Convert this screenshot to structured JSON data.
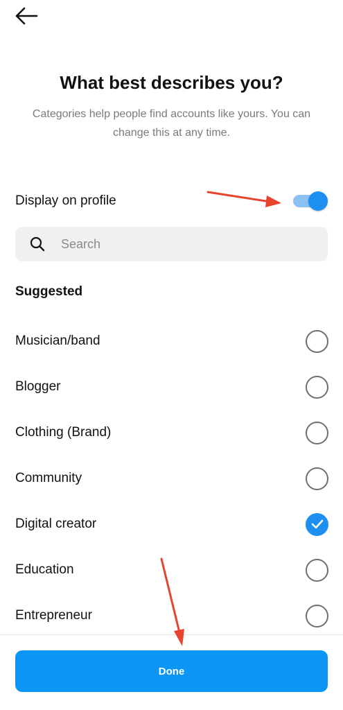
{
  "header": {
    "back_icon": "arrow-left-icon"
  },
  "intro": {
    "title": "What best describes you?",
    "subtitle": "Categories help people find accounts like yours. You can change this at any time."
  },
  "display_on_profile": {
    "label": "Display on profile",
    "enabled": true
  },
  "search": {
    "placeholder": "Search",
    "value": "",
    "icon": "search-icon"
  },
  "suggested": {
    "title": "Suggested",
    "options": [
      {
        "label": "Musician/band",
        "selected": false
      },
      {
        "label": "Blogger",
        "selected": false
      },
      {
        "label": "Clothing (Brand)",
        "selected": false
      },
      {
        "label": "Community",
        "selected": false
      },
      {
        "label": "Digital creator",
        "selected": true
      },
      {
        "label": "Education",
        "selected": false
      },
      {
        "label": "Entrepreneur",
        "selected": false
      }
    ]
  },
  "footer": {
    "done_label": "Done"
  },
  "colors": {
    "accent": "#0d95f6",
    "toggle_track": "#8cc1f4",
    "annotation_arrow": "#e8432e"
  }
}
